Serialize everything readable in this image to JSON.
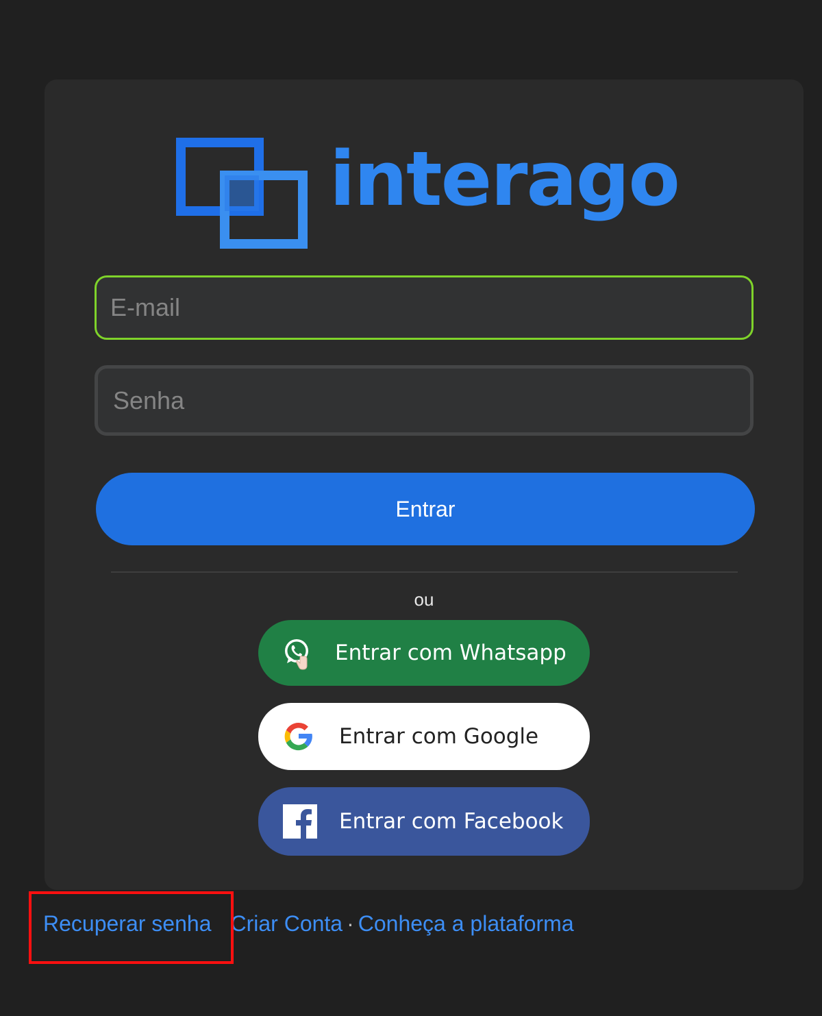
{
  "brand": {
    "name": "interago",
    "color": "#2f86f0"
  },
  "form": {
    "email_placeholder": "E-mail",
    "password_placeholder": "Senha",
    "submit_label": "Entrar",
    "divider_text": "ou"
  },
  "social": {
    "whatsapp": {
      "label": "Entrar com Whatsapp",
      "icon": "whatsapp-icon",
      "color": "#208045"
    },
    "google": {
      "label": "Entrar com Google",
      "icon": "google-icon",
      "color": "#ffffff"
    },
    "facebook": {
      "label": "Entrar com Facebook",
      "icon": "facebook-icon",
      "color": "#3a569c"
    }
  },
  "footer": {
    "recover_password": "Recuperar senha",
    "create_account": "Criar Conta",
    "separator": "·",
    "discover_platform": "Conheça a plataforma"
  },
  "colors": {
    "primary": "#1f70e0",
    "email_focus_border": "#7fd32a",
    "highlight_box": "#ff1010",
    "link": "#3d8ef5"
  }
}
